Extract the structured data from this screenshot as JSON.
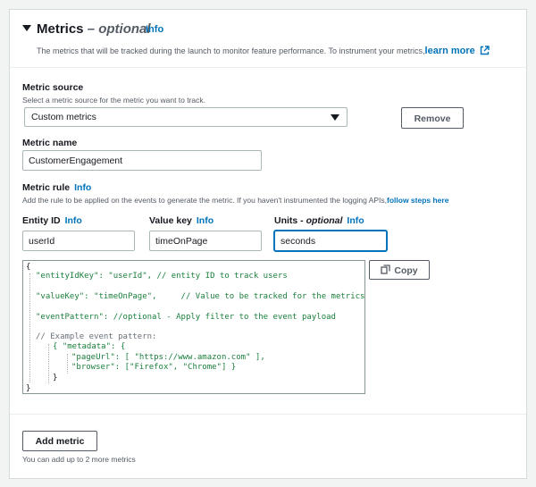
{
  "header": {
    "title": "Metrics",
    "title_optional": "– optional",
    "info": "Info",
    "description": "The metrics that will be tracked during the launch to monitor feature performance. To instrument your metrics,",
    "learn_more": "learn more"
  },
  "metric_source": {
    "label": "Metric source",
    "description": "Select a metric source for the metric you want to track.",
    "selected": "Custom metrics",
    "remove_button": "Remove"
  },
  "metric_name": {
    "label": "Metric name",
    "value": "CustomerEngagement"
  },
  "metric_rule": {
    "label": "Metric rule",
    "info": "Info",
    "description": "Add the rule to be applied on the events to generate the metric. If you haven't instrumented the logging APIs,",
    "follow_steps": "follow steps here"
  },
  "entity_id": {
    "label": "Entity ID",
    "info": "Info",
    "value": "userId"
  },
  "value_key": {
    "label": "Value key",
    "info": "Info",
    "value": "timeOnPage"
  },
  "units": {
    "label": "Units",
    "optional": "- optional",
    "info": "Info",
    "value": "seconds"
  },
  "code_editor": {
    "lines": [
      "{",
      "\"entityIdKey\": \"userId\", // entity ID to track users",
      "\"valueKey\": \"timeOnPage\",     // Value to be tracked for the metrics",
      "\"eventPattern\": //optional - Apply filter to the event payload",
      "// Example event pattern:",
      "{ \"metadata\": {",
      "\"pageUrl\": [ \"https://www.amazon.com\" ],",
      "\"browser\": [\"Firefox\", \"Chrome\"] }",
      "}",
      "}"
    ],
    "copy_button": "Copy"
  },
  "footer": {
    "add_metric_button": "Add metric",
    "hint": "You can add up to 2 more metrics"
  },
  "colors": {
    "link": "#0073bb",
    "code_key": "#1a7f3c",
    "focus_border": "#0073bb"
  }
}
